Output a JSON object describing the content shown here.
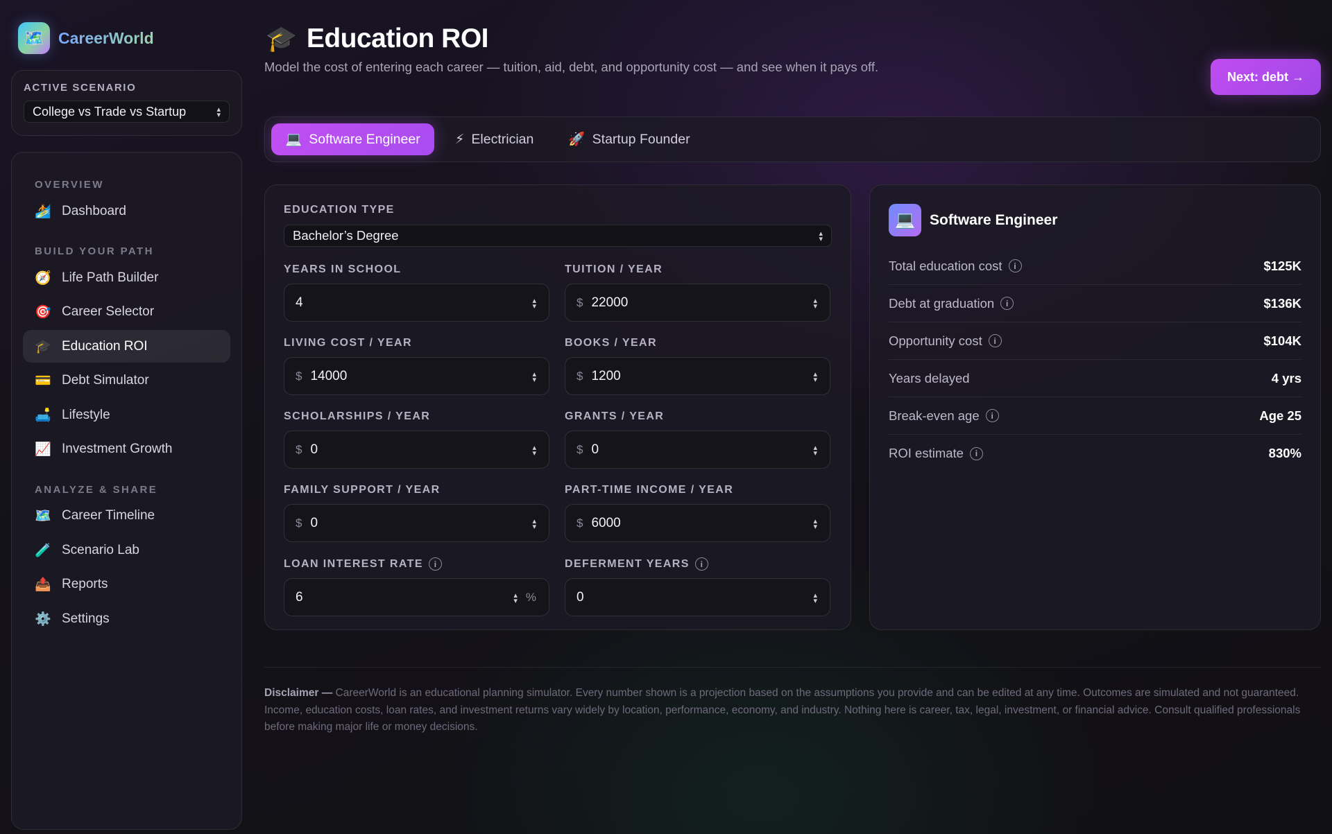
{
  "brand": {
    "icon": "map-icon",
    "name": "CareerWorld"
  },
  "scenario": {
    "label": "ACTIVE SCENARIO",
    "value": "College vs Trade vs Startup"
  },
  "nav": {
    "sections": [
      {
        "title": "OVERVIEW",
        "items": [
          {
            "icon": "dashboard-icon",
            "label": "Dashboard"
          }
        ]
      },
      {
        "title": "BUILD YOUR PATH",
        "items": [
          {
            "icon": "compass-icon",
            "label": "Life Path Builder"
          },
          {
            "icon": "target-icon",
            "label": "Career Selector"
          },
          {
            "icon": "graduation-cap-icon",
            "label": "Education ROI",
            "active": true
          },
          {
            "icon": "credit-card-icon",
            "label": "Debt Simulator"
          },
          {
            "icon": "couch-icon",
            "label": "Lifestyle"
          },
          {
            "icon": "chart-up-icon",
            "label": "Investment Growth"
          }
        ]
      },
      {
        "title": "ANALYZE & SHARE",
        "items": [
          {
            "icon": "map-icon",
            "label": "Career Timeline"
          },
          {
            "icon": "test-tube-icon",
            "label": "Scenario Lab"
          },
          {
            "icon": "outbox-icon",
            "label": "Reports"
          },
          {
            "icon": "gear-icon",
            "label": "Settings"
          }
        ]
      }
    ]
  },
  "header": {
    "title": "Education ROI",
    "subtitle": "Model the cost of entering each career — tuition, aid, debt, and opportunity cost — and see when it pays off.",
    "next_button": "Next: debt →"
  },
  "tabs": [
    {
      "icon": "laptop-icon",
      "label": "Software Engineer",
      "active": true
    },
    {
      "icon": "lightning-icon",
      "label": "Electrician"
    },
    {
      "icon": "rocket-icon",
      "label": "Startup Founder"
    }
  ],
  "form": {
    "education_type": {
      "label": "EDUCATION TYPE",
      "value": "Bachelor’s Degree"
    },
    "years_in_school": {
      "label": "YEARS IN SCHOOL",
      "value": "4"
    },
    "tuition": {
      "label": "TUITION / YEAR",
      "currency": "$",
      "value": "22000"
    },
    "living_cost": {
      "label": "LIVING COST / YEAR",
      "currency": "$",
      "value": "14000"
    },
    "books": {
      "label": "BOOKS / YEAR",
      "currency": "$",
      "value": "1200"
    },
    "scholarships": {
      "label": "SCHOLARSHIPS / YEAR",
      "currency": "$",
      "value": "0"
    },
    "grants": {
      "label": "GRANTS / YEAR",
      "currency": "$",
      "value": "0"
    },
    "family_support": {
      "label": "FAMILY SUPPORT / YEAR",
      "currency": "$",
      "value": "0"
    },
    "part_time_income": {
      "label": "PART-TIME INCOME / YEAR",
      "currency": "$",
      "value": "6000"
    },
    "loan_interest": {
      "label": "LOAN INTEREST RATE",
      "value": "6",
      "unit": "%"
    },
    "deferment": {
      "label": "DEFERMENT YEARS",
      "value": "0"
    }
  },
  "summary": {
    "title": "Software Engineer",
    "metrics": [
      {
        "label": "Total education cost",
        "value": "$125K",
        "info": true
      },
      {
        "label": "Debt at graduation",
        "value": "$136K",
        "info": true
      },
      {
        "label": "Opportunity cost",
        "value": "$104K",
        "info": true
      },
      {
        "label": "Years delayed",
        "value": "4 yrs",
        "info": false
      },
      {
        "label": "Break-even age",
        "value": "Age 25",
        "info": true
      },
      {
        "label": "ROI estimate",
        "value": "830%",
        "info": true
      }
    ]
  },
  "disclaimer": {
    "lead": "Disclaimer —",
    "text": "CareerWorld is an educational planning simulator. Every number shown is a projection based on the assumptions you provide and can be edited at any time. Outcomes are simulated and not guaranteed. Income, education costs, loan rates, and investment returns vary widely by location, performance, economy, and industry. Nothing here is career, tax, legal, investment, or financial advice. Consult qualified professionals before making major life or money decisions."
  },
  "colors": {
    "accent": "#B84EF0",
    "background": "#141219"
  }
}
